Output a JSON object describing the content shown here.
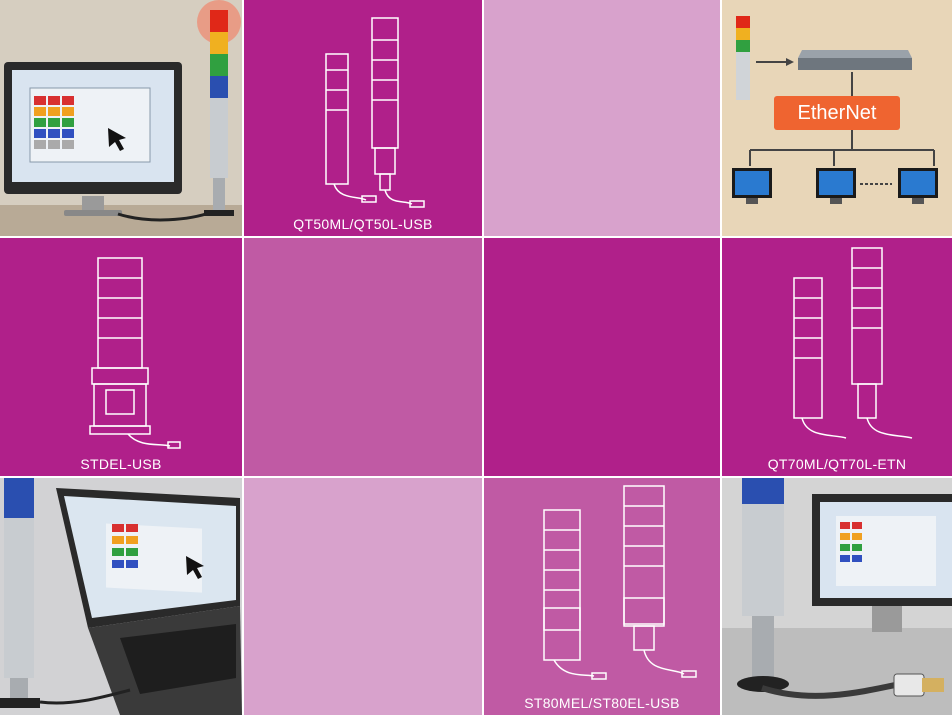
{
  "colors": {
    "magenta_dark": "#b0208a",
    "magenta_mid": "#c05aa4",
    "pink_light": "#d8a2cc",
    "tan_bg": "#e8d6b8",
    "ethernet_orange": "#ef6430"
  },
  "tiles": {
    "qt50": {
      "caption": "QT50ML/QT50L-USB"
    },
    "ethernet": {
      "badge": "EtherNet"
    },
    "stdel": {
      "caption": "STDEL-USB"
    },
    "qt70": {
      "caption": "QT70ML/QT70L-ETN"
    },
    "st80": {
      "caption": "ST80MEL/ST80EL-USB"
    }
  },
  "icons": [
    "signal-tower-icon",
    "monitor-icon",
    "laptop-icon",
    "network-switch-icon",
    "usb-cable-icon",
    "ethernet-plug-icon"
  ]
}
